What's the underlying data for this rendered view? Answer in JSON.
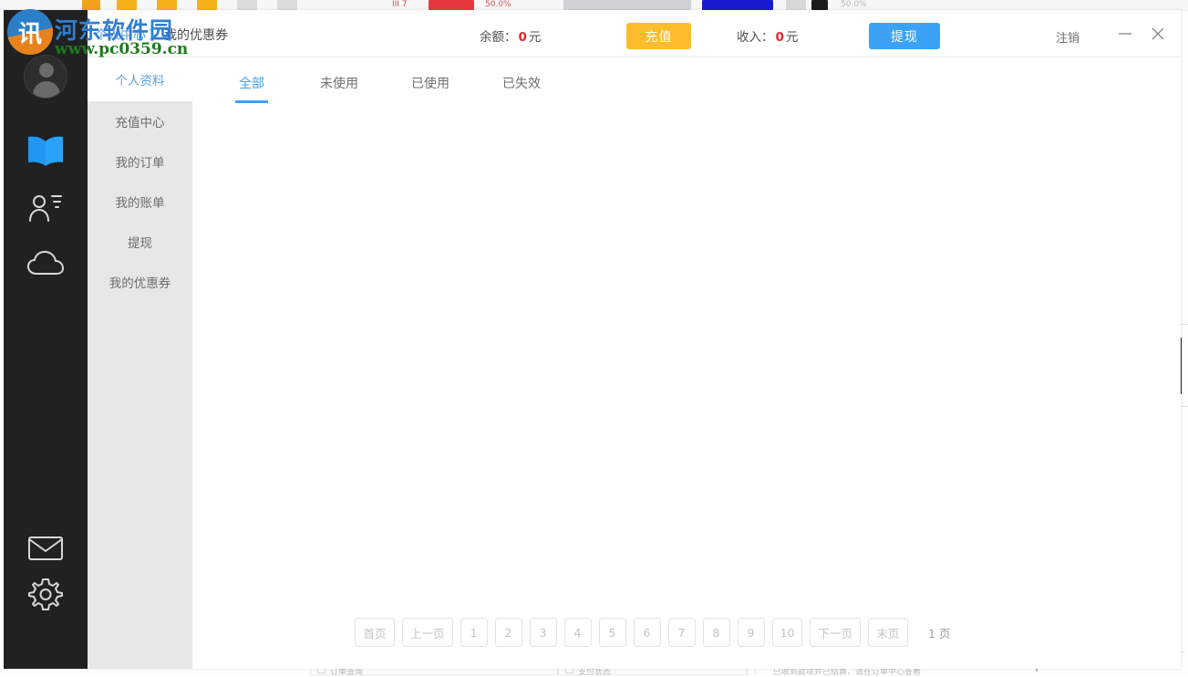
{
  "window": {
    "breadcrumb_parent": "个人中心",
    "breadcrumb_separator": "〉",
    "breadcrumb_current": "我的优惠券",
    "logout_label": "注销",
    "minimize_label": "—",
    "close_label": "✕"
  },
  "topbar": {
    "balance_label": "余额：",
    "balance_amount": "0",
    "balance_unit": "元",
    "recharge_label": "充值",
    "income_label": "收入：",
    "income_amount": "0",
    "income_unit": "元",
    "withdraw_label": "提现",
    "recharge_color": "#fbbd2c",
    "withdraw_color": "#3ba2f5",
    "amount_color": "#e8262f"
  },
  "rail": {
    "items": [
      {
        "icon": "avatar-icon",
        "name": "user-avatar"
      },
      {
        "icon": "book-icon",
        "name": "library-icon",
        "active": true,
        "color": "#2196f3"
      },
      {
        "icon": "user-list-icon",
        "name": "contacts-icon"
      },
      {
        "icon": "cloud-icon",
        "name": "cloud-icon"
      },
      {
        "icon": "mail-icon",
        "name": "mail-icon"
      },
      {
        "icon": "gear-icon",
        "name": "settings-icon"
      }
    ]
  },
  "sidebar": {
    "profile_label": "个人资料",
    "items": [
      {
        "label": "充值中心",
        "name": "recharge-center"
      },
      {
        "label": "我的订单",
        "name": "my-orders"
      },
      {
        "label": "我的账单",
        "name": "my-bills"
      },
      {
        "label": "提现",
        "name": "withdraw"
      },
      {
        "label": "我的优惠券",
        "name": "my-coupons",
        "active": true
      }
    ]
  },
  "tabs": [
    {
      "label": "全部",
      "active": true
    },
    {
      "label": "未使用",
      "active": false
    },
    {
      "label": "已使用",
      "active": false
    },
    {
      "label": "已失效",
      "active": false
    }
  ],
  "pagination": {
    "first_label": "首页",
    "prev_label": "上一页",
    "pages": [
      "1",
      "2",
      "3",
      "4",
      "5",
      "6",
      "7",
      "8",
      "9",
      "10"
    ],
    "next_label": "下一页",
    "last_label": "末页",
    "total_label": "1 页"
  },
  "watermark": {
    "logo_glyph": "讯",
    "title": "河东软件园",
    "url": "www.pc0359.cn",
    "title_color": "#2f7fd4",
    "url_color": "#1d7a1d"
  },
  "background": {
    "bottom_left_text": "订单查询",
    "bottom_mid_text": "支付状态",
    "bottom_right_text": "已收到款项并已结算，请在订单中心查看"
  }
}
